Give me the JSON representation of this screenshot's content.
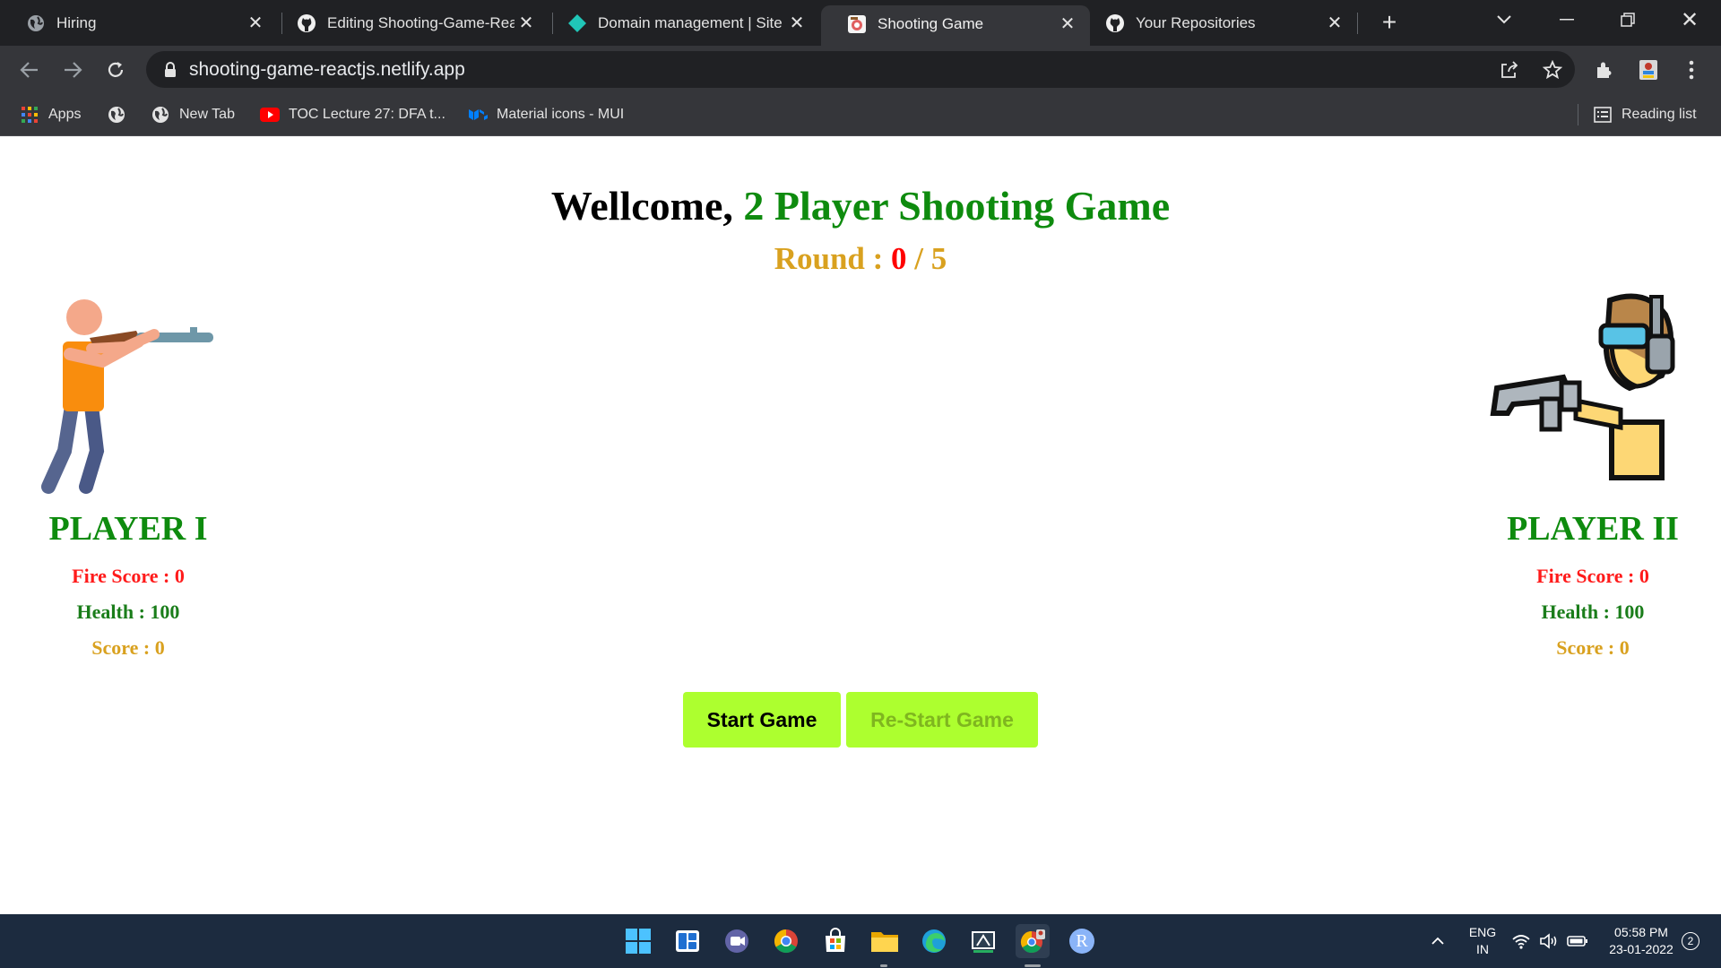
{
  "browser": {
    "tabs": [
      {
        "title": "Hiring",
        "icon": "globe-icon"
      },
      {
        "title": "Editing Shooting-Game-ReactJS",
        "icon": "github-icon"
      },
      {
        "title": "Domain management | Site",
        "icon": "netlify-icon"
      },
      {
        "title": "Shooting Game",
        "icon": "shooting-game-icon",
        "active": true
      },
      {
        "title": "Your Repositories",
        "icon": "github-icon"
      }
    ],
    "url": "shooting-game-reactjs.netlify.app",
    "bookmarks": [
      {
        "label": "Apps",
        "icon": "apps-grid-icon"
      },
      {
        "label": "",
        "icon": "globe-icon"
      },
      {
        "label": "New Tab",
        "icon": "globe-icon"
      },
      {
        "label": "TOC Lecture 27: DFA t...",
        "icon": "youtube-icon"
      },
      {
        "label": "Material icons - MUI",
        "icon": "mui-icon"
      }
    ],
    "reading_list": "Reading list"
  },
  "game": {
    "welcome": "Wellcome,",
    "title": "2 Player Shooting Game",
    "round_label": "Round :",
    "round_current": "0",
    "round_total": "/ 5",
    "player1": {
      "name": "PLAYER I",
      "fire_score": "Fire Score : 0",
      "health": "Health : 100",
      "score": "Score : 0"
    },
    "player2": {
      "name": "PLAYER II",
      "fire_score": "Fire Score : 0",
      "health": "Health : 100",
      "score": "Score : 0"
    },
    "start_button": "Start Game",
    "restart_button": "Re-Start Game",
    "colors": {
      "title_green": "#0e8b0e",
      "round_gold": "#d9a11f",
      "fire_red": "#ff1a1a",
      "button_lime": "#adff2f"
    }
  },
  "taskbar": {
    "language_top": "ENG",
    "language_bottom": "IN",
    "time": "05:58 PM",
    "date": "23-01-2022",
    "notification_count": "2",
    "profile_letter": "R"
  }
}
